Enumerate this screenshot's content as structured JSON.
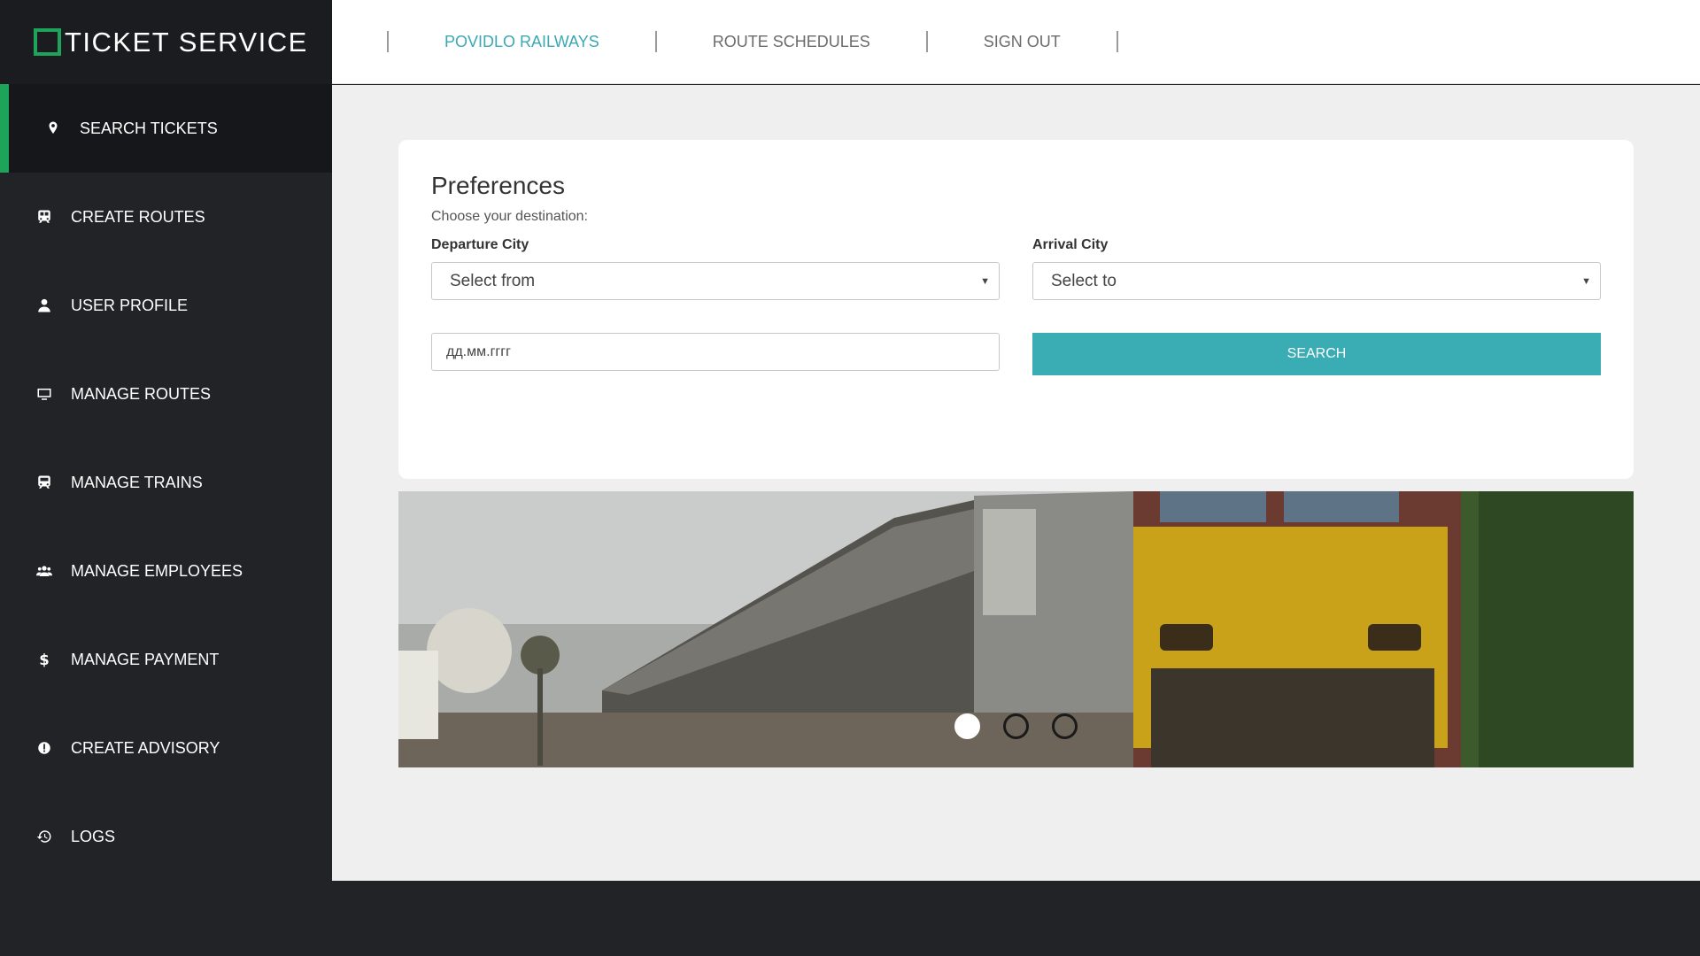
{
  "brand": {
    "title": "TICKET SERVICE"
  },
  "sidebar": {
    "items": [
      {
        "label": "SEARCH TICKETS",
        "icon": "map-marker-icon"
      },
      {
        "label": "CREATE ROUTES",
        "icon": "train-icon"
      },
      {
        "label": "USER PROFILE",
        "icon": "user-icon"
      },
      {
        "label": "MANAGE ROUTES",
        "icon": "monitor-icon"
      },
      {
        "label": "MANAGE TRAINS",
        "icon": "train-icon"
      },
      {
        "label": "MANAGE EMPLOYEES",
        "icon": "users-icon"
      },
      {
        "label": "MANAGE PAYMENT",
        "icon": "dollar-icon"
      },
      {
        "label": "CREATE ADVISORY",
        "icon": "alert-icon"
      },
      {
        "label": "LOGS",
        "icon": "history-icon"
      }
    ]
  },
  "topnav": {
    "items": [
      {
        "label": "POVIDLO RAILWAYS"
      },
      {
        "label": "ROUTE SCHEDULES"
      },
      {
        "label": "SIGN OUT"
      }
    ]
  },
  "preferences": {
    "title": "Preferences",
    "subtitle": "Choose your destination:",
    "departure": {
      "label": "Departure City",
      "value": "Select from"
    },
    "arrival": {
      "label": "Arrival City",
      "value": "Select to"
    },
    "date": {
      "value": "дд.мм.гггг"
    },
    "search_label": "SEARCH"
  },
  "carousel": {
    "slide_count": 3,
    "active_index": 0
  },
  "colors": {
    "accent": "#1ea35a",
    "teal": "#3aacb4",
    "sidebar": "#222327"
  }
}
